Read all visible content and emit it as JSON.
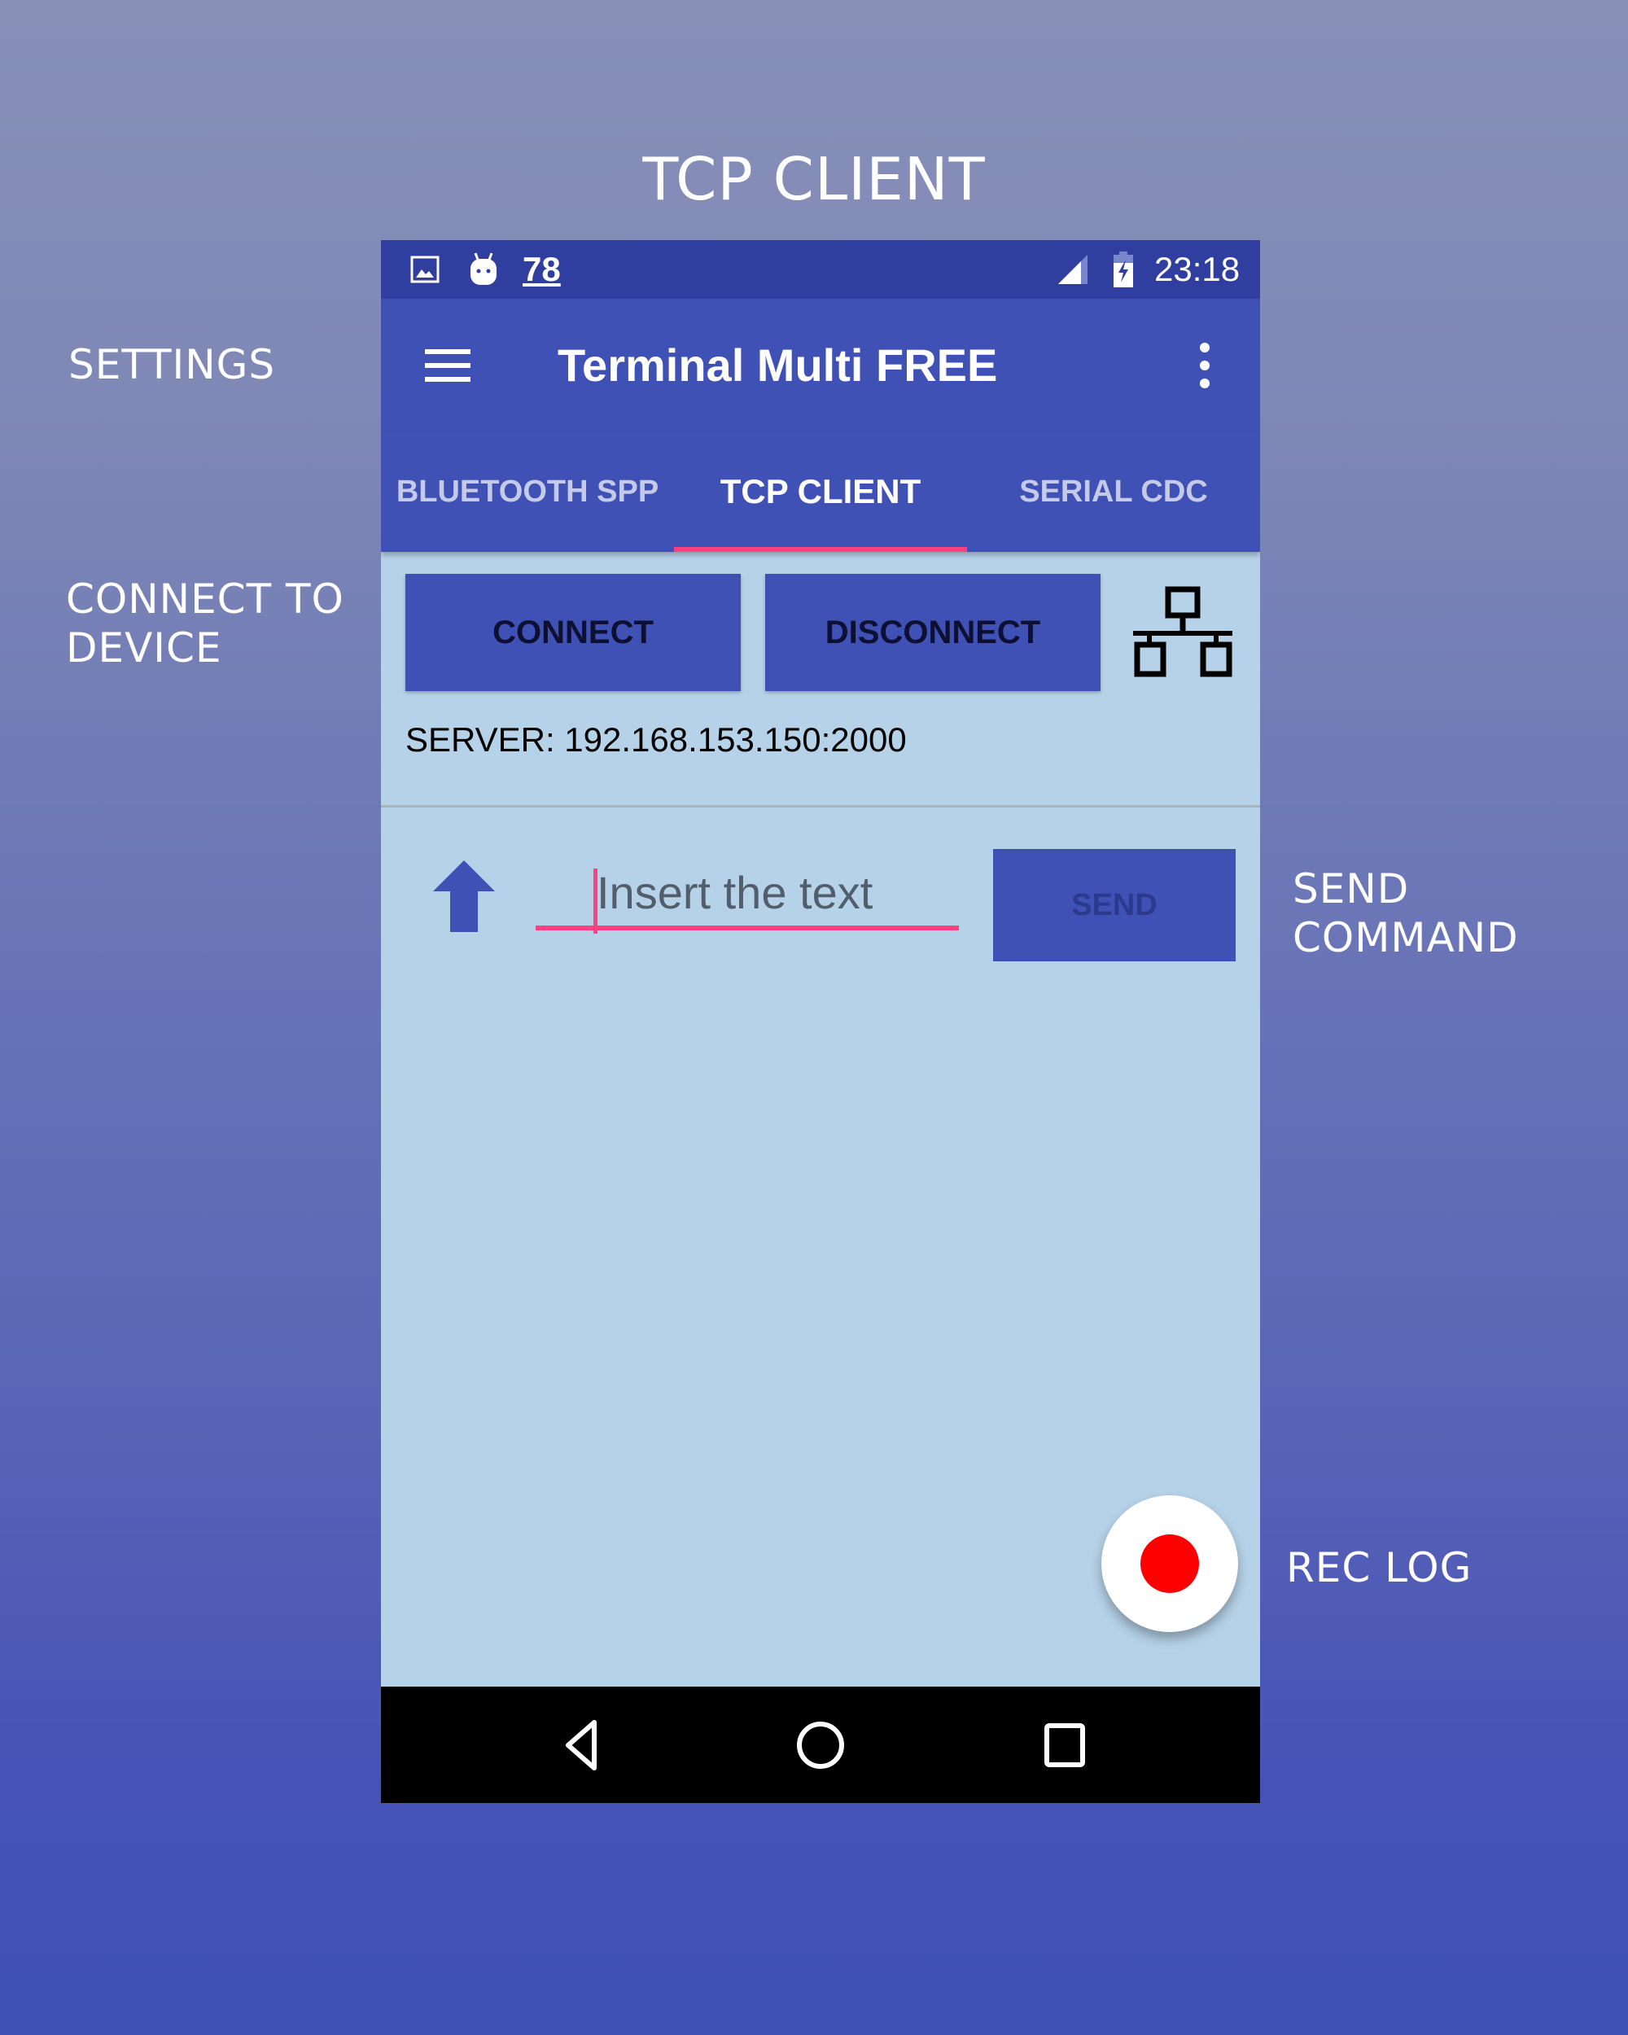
{
  "annotations": {
    "title": "TCP CLIENT",
    "settings": "SETTINGS",
    "connect": "CONNECT TO\nDEVICE",
    "send": "SEND\nCOMMAND",
    "rec": "REC LOG"
  },
  "status_bar": {
    "icons": [
      "image-icon",
      "android-debug-icon",
      "usb-icon"
    ],
    "notification_count": "78",
    "right_icons": [
      "signal-icon",
      "battery-charging-icon"
    ],
    "time": "23:18"
  },
  "toolbar": {
    "title": "Terminal Multi FREE",
    "menu_icon": "hamburger-menu-icon",
    "overflow_icon": "more-vert-icon"
  },
  "tabs": [
    {
      "label": "BLUETOOTH SPP",
      "active": false
    },
    {
      "label": "TCP CLIENT",
      "active": true
    },
    {
      "label": "SERIAL CDC",
      "active": false
    }
  ],
  "content": {
    "connect_label": "CONNECT",
    "disconnect_label": "DISCONNECT",
    "network_icon": "network-icon",
    "server_text": "SERVER: 192.168.153.150:2000",
    "input_value": "",
    "input_placeholder": "Insert the text",
    "send_label": "SEND",
    "history_icon": "arrow-up-icon",
    "fab_icon": "record-icon"
  },
  "nav_bar": {
    "back_icon": "back-icon",
    "home_icon": "home-icon",
    "recents_icon": "recents-icon"
  },
  "colors": {
    "primary": "#3f51b5",
    "primary_dark": "#303f9f",
    "accent": "#ff4081",
    "content_bg": "#b6d2e8",
    "record": "#ff0000"
  }
}
